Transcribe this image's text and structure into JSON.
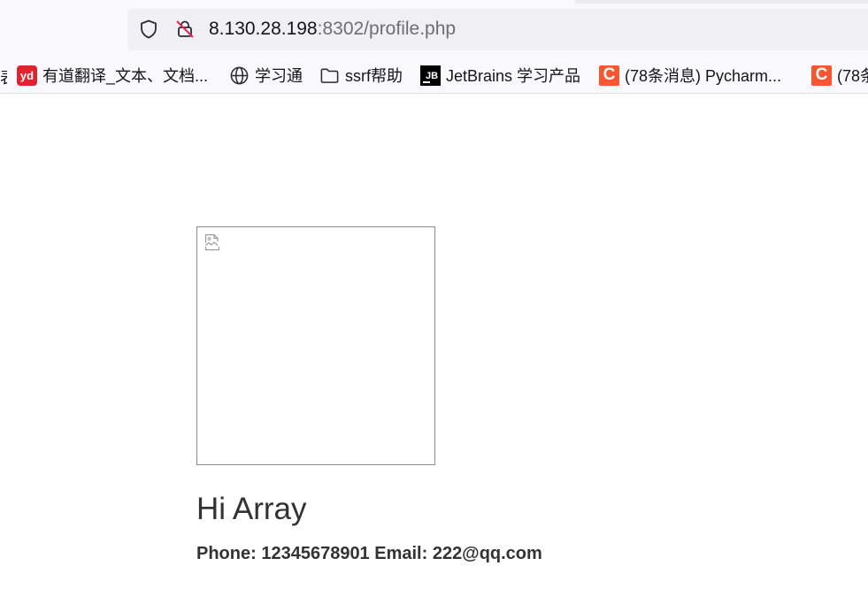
{
  "browser": {
    "url": {
      "host": "8.130.28.198",
      "rest": ":8302/profile.php"
    },
    "bookmarks": [
      {
        "label": "有道翻译_文本、文档...",
        "icon": "youdao-icon",
        "icon_text": "yd"
      },
      {
        "label": "学习通",
        "icon": "globe-icon"
      },
      {
        "label": "ssrf帮助",
        "icon": "folder-icon"
      },
      {
        "label": "JetBrains 学习产品",
        "icon": "jetbrains-icon",
        "icon_text": "JB"
      },
      {
        "label": "(78条消息) Pycharm...",
        "icon": "csdn-icon",
        "icon_text": "C"
      },
      {
        "label": "(78条",
        "icon": "csdn-icon",
        "icon_text": "C"
      }
    ]
  },
  "profile": {
    "greeting": "Hi Array",
    "contact": "Phone: 12345678901 Email: 222@qq.com",
    "avatar_icon": "broken-image-icon"
  },
  "colors": {
    "text": "#333333",
    "csdn": "#fc5531",
    "youdao": "#e4212f"
  }
}
